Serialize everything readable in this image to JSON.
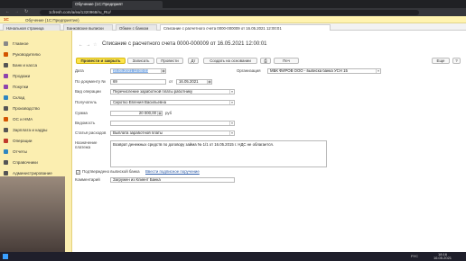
{
  "browser": {
    "tabs": [
      "Обучение (1С:Предприят"
    ],
    "url": "1cfresh.com/a/ea/1320968/ru_RU/"
  },
  "app_header": {
    "title": "Обучение (1С:Предприятие)"
  },
  "app_tabs": [
    "Начальная страница",
    "Банковские выписки",
    "Обмен с банком",
    "Списание с расчетного счета 0000-000009 от 16.05.2021 12:00:01"
  ],
  "sidebar": [
    "Главное",
    "Руководителю",
    "Банк и касса",
    "Продажи",
    "Покупки",
    "Склад",
    "Производство",
    "ОС и НМА",
    "Зарплата и кадры",
    "Операции",
    "Отчеты",
    "Справочники",
    "Администрирование"
  ],
  "doc": {
    "title": "Списание с расчетного счета 0000-000009 от 16.05.2021 12:00:01",
    "btn_post_close": "Провести и закрыть",
    "btn_save": "Записать",
    "btn_post": "Провести",
    "btn_create_based": "Создать на основании",
    "btn_print": "Печ",
    "btn_more": "Еще",
    "btn_help": "?",
    "label_date": "Дата",
    "date_value": "16.05.2021 12:00:01",
    "label_org": "Организация",
    "org_value": "МБК ФИРОВ ООО - выписка банка УСН 15",
    "label_doc_num": "По документу №",
    "doc_num_value": "69",
    "label_from": "от",
    "doc_date_value": "16.05.2021",
    "label_op_type": "Вид операции",
    "op_type_value": "Перечисление заработной платы работнику",
    "label_recipient": "Получатель",
    "recipient_value": "Сиротко Евгения Васильевна",
    "label_sum": "Сумма",
    "sum_value": "20 000,00",
    "sum_currency": "руб",
    "label_statement": "Ведомость",
    "statement_value": "",
    "label_expense": "Статья расходов",
    "expense_value": "Выплата заработной платы",
    "label_purpose": "Назначение платежа",
    "purpose_value": "Возврат денежных средств по договору займа № 1/1 от 16.05.2015 г. НДС не облагается.",
    "confirmed_label": "Подтверждено выпиской банка",
    "enter_payment_link": "Ввести подписное поручение",
    "label_comment": "Комментарий",
    "comment_value": "Загружен из Клиент Банка"
  },
  "taskbar": {
    "time": "18:16",
    "date": "16.05.2021",
    "lang": "РУС"
  },
  "colors": {
    "accent": "#fce34a",
    "sidebar": "#fbeeb0",
    "selected": "#8ab4e9"
  }
}
